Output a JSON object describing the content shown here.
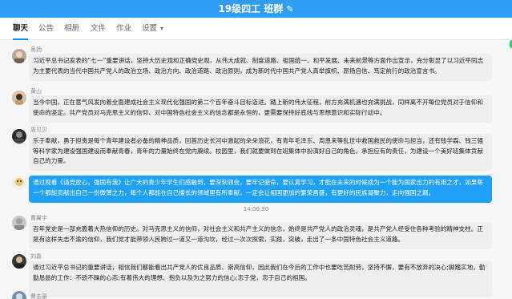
{
  "title": {
    "text": "19级四工 班群",
    "edit_icon": "pencil-icon"
  },
  "tabs": [
    {
      "label": "聊天",
      "active": true
    },
    {
      "label": "公告"
    },
    {
      "label": "相册"
    },
    {
      "label": "文件"
    },
    {
      "label": "作业"
    },
    {
      "label": "设置"
    }
  ],
  "messages": [
    {
      "name": "吴扬",
      "text": "习近平总书记发表的“七一”重要讲话，坚持大历史观和正确党史观，从伟大成就、制度道路、祖国统一、和平发展、未来前景等方面作出宣示，充分彰显了以习近平同志为主要代表的当代中国共产党人的政治立场、政治方向、政治道路、政治原则，成为新时代中国共产党人高举旗帜、昂扬自信、笃定前行的政治宣言书。"
    },
    {
      "name": "黄山",
      "text": "当今中国，正在意气风发向着全面建成社会主义现代化强国的第二个百年奋斗目标迈进。踏上新的伟大征程，前方充满机遇也充满挑战，同样离不开每位党员对于信仰和使命的坚定。共产党员对马克思主义的信仰、对中国特色社会主义的信念都是永恒的，更需要保持好底线与思想意识和实际行动中。"
    },
    {
      "name": "周贝贝",
      "text": "乐于奉献，勇于担责是每个青年建设者必备的精神品质，回首历史长河中激起的朵朵浪花，有青年毛泽东、周恩来等乱世中救国救民的使命与担当，还有钱学森、钱三强等科学家为建设强国建设而奉献青春，青年的力量始终在党内赓续。校园里，我们就要做到在班集体中扮演好自己的角色，承担应有的责任，为建设一个美好班集体贡献自己的力量。"
    },
    {
      "name": "",
      "text": "通过观看《请党放心，强国有我》让广大的青少年学生们感触到，要深刻领会，要牢记使命，要认真学习，才能在未来的时候成为一个能为国家出力的有用之才，如果每一个都能贡献出自己一份微薄之力，每个人都能在自己擅长的领域里有所奉献，一定会让祖国更加的繁荣昌盛，有更好的民族凝聚力，走向强国之巅。"
    },
    {
      "name": "曹翼宇",
      "text": "百年党史是一部充盈着大热信仰的历史。对马克思主义的信仰，对社会主义和共产主义的信念，始终是共产党人的政治灵魂，是共产党人经受住各种考验的精神支柱。正是有这样失志不渝的信仰，我们党才能带领人民跨过一道又一道沟坎，经过一次次探索，实践，突破，走出了一条中国特色社会主义道路。"
    },
    {
      "name": "刘磊",
      "text": "通过习近平总书记的重要讲话，相信我们都能看出共产党人的优良品质、崇高信仰，因此我们在今后的工作中也要吃苦耐劳，坚持不懈，要有不放弃的决心;脚踏实地，勤勤恳恳的工作：不骄不躁的心态;有着伟大的理想、抱负以及为之努力的信心;忠于党，忠于自己的祖国。"
    },
    {
      "name": "曹志豪",
      "text": ""
    }
  ],
  "timestamp": "14:00:30",
  "colors": {
    "titlebar": "#2f9ef0",
    "accent": "#1f8ef1",
    "highlight_bubble": "#1ea1f6",
    "bubble": "#eceef1"
  }
}
